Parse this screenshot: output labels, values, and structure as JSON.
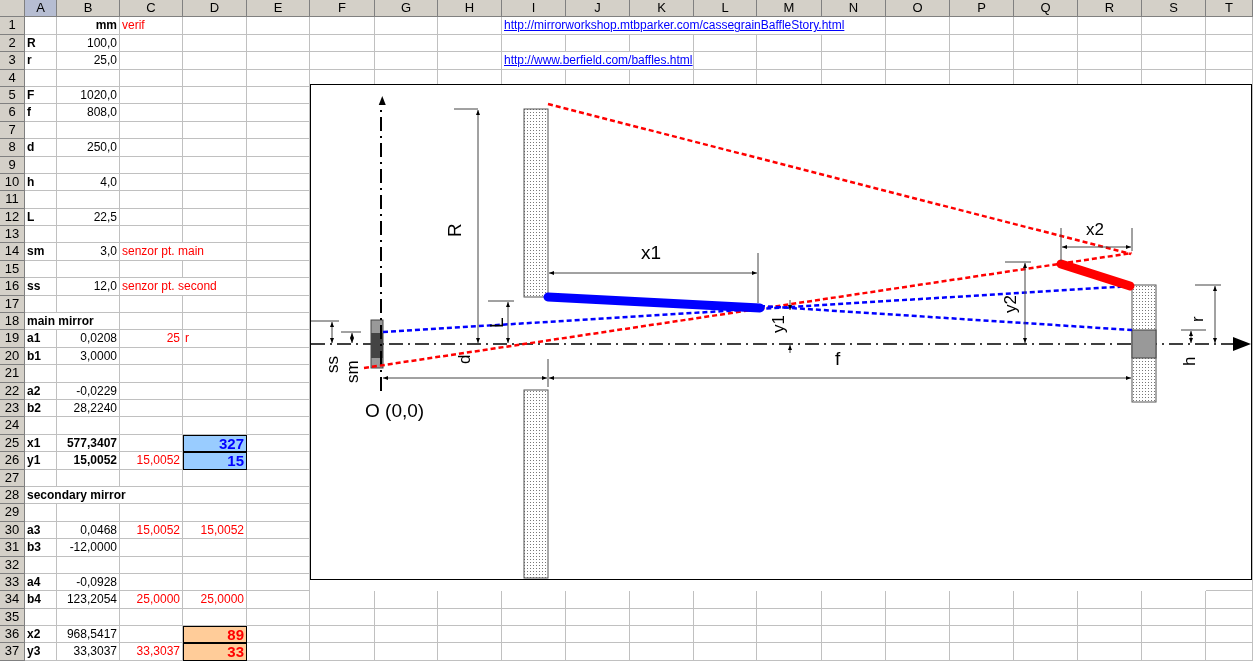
{
  "columns": [
    {
      "label": "A",
      "selected": true
    },
    {
      "label": "B",
      "selected": false
    },
    {
      "label": "C",
      "selected": false
    },
    {
      "label": "D",
      "selected": false
    },
    {
      "label": "E",
      "selected": false
    },
    {
      "label": "F",
      "selected": false
    },
    {
      "label": "G",
      "selected": false
    },
    {
      "label": "H",
      "selected": false
    },
    {
      "label": "I",
      "selected": false
    },
    {
      "label": "J",
      "selected": false
    },
    {
      "label": "K",
      "selected": false
    },
    {
      "label": "L",
      "selected": false
    },
    {
      "label": "M",
      "selected": false
    },
    {
      "label": "N",
      "selected": false
    },
    {
      "label": "O",
      "selected": false
    },
    {
      "label": "P",
      "selected": false
    },
    {
      "label": "Q",
      "selected": false
    },
    {
      "label": "R",
      "selected": false
    },
    {
      "label": "S",
      "selected": false
    },
    {
      "label": "T",
      "selected": false
    }
  ],
  "rows": [
    {
      "number": "1",
      "cells": {
        "B": {
          "text": "mm",
          "kind": "value_bold"
        },
        "C": {
          "text": "verif",
          "kind": "note"
        },
        "I": {
          "text": "http://mirrorworkshop.mtbparker.com/cassegrainBaffleStory.html",
          "kind": "link"
        }
      }
    },
    {
      "number": "2",
      "cells": {
        "A": {
          "text": "R",
          "kind": "label"
        },
        "B": {
          "text": "100,0",
          "kind": "value"
        }
      }
    },
    {
      "number": "3",
      "cells": {
        "A": {
          "text": "r",
          "kind": "label"
        },
        "B": {
          "text": "25,0",
          "kind": "value"
        },
        "I": {
          "text": "http://www.berfield.com/baffles.html",
          "kind": "link"
        }
      }
    },
    {
      "number": "4"
    },
    {
      "number": "5",
      "cells": {
        "A": {
          "text": "F",
          "kind": "label"
        },
        "B": {
          "text": "1020,0",
          "kind": "value"
        }
      }
    },
    {
      "number": "6",
      "cells": {
        "A": {
          "text": "f",
          "kind": "label"
        },
        "B": {
          "text": "808,0",
          "kind": "value"
        }
      }
    },
    {
      "number": "7"
    },
    {
      "number": "8",
      "cells": {
        "A": {
          "text": "d",
          "kind": "label"
        },
        "B": {
          "text": "250,0",
          "kind": "value"
        }
      }
    },
    {
      "number": "9"
    },
    {
      "number": "10",
      "cells": {
        "A": {
          "text": "h",
          "kind": "label"
        },
        "B": {
          "text": "4,0",
          "kind": "value"
        }
      }
    },
    {
      "number": "11"
    },
    {
      "number": "12",
      "cells": {
        "A": {
          "text": "L",
          "kind": "label"
        },
        "B": {
          "text": "22,5",
          "kind": "value"
        }
      }
    },
    {
      "number": "13"
    },
    {
      "number": "14",
      "cells": {
        "A": {
          "text": "sm",
          "kind": "label"
        },
        "B": {
          "text": "3,0",
          "kind": "value"
        },
        "C": {
          "text": "senzor pt. main",
          "kind": "note"
        }
      }
    },
    {
      "number": "15"
    },
    {
      "number": "16",
      "cells": {
        "A": {
          "text": "ss",
          "kind": "label"
        },
        "B": {
          "text": "12,0",
          "kind": "value"
        },
        "C": {
          "text": "senzor pt. second",
          "kind": "note"
        }
      }
    },
    {
      "number": "17"
    },
    {
      "number": "18",
      "cells": {
        "A": {
          "text": "main mirror",
          "kind": "label"
        }
      }
    },
    {
      "number": "19",
      "cells": {
        "A": {
          "text": "a1",
          "kind": "label"
        },
        "B": {
          "text": "0,0208",
          "kind": "value"
        },
        "C": {
          "text": "25",
          "kind": "check"
        },
        "D": {
          "text": "r",
          "kind": "note"
        }
      }
    },
    {
      "number": "20",
      "cells": {
        "A": {
          "text": "b1",
          "kind": "label"
        },
        "B": {
          "text": "3,0000",
          "kind": "value"
        }
      }
    },
    {
      "number": "21"
    },
    {
      "number": "22",
      "cells": {
        "A": {
          "text": "a2",
          "kind": "label"
        },
        "B": {
          "text": "-0,0229",
          "kind": "value"
        }
      }
    },
    {
      "number": "23",
      "cells": {
        "A": {
          "text": "b2",
          "kind": "label"
        },
        "B": {
          "text": "28,2240",
          "kind": "value"
        }
      }
    },
    {
      "number": "24"
    },
    {
      "number": "25",
      "cells": {
        "A": {
          "text": "x1",
          "kind": "label"
        },
        "B": {
          "text": "577,3407",
          "kind": "value_bold"
        },
        "D": {
          "text": "327",
          "kind": "result_blue"
        }
      }
    },
    {
      "number": "26",
      "cells": {
        "A": {
          "text": "y1",
          "kind": "label"
        },
        "B": {
          "text": "15,0052",
          "kind": "value_bold"
        },
        "C": {
          "text": "15,0052",
          "kind": "check"
        },
        "D": {
          "text": "15",
          "kind": "result_blue"
        }
      }
    },
    {
      "number": "27"
    },
    {
      "number": "28",
      "cells": {
        "A": {
          "text": "secondary mirror",
          "kind": "label"
        }
      }
    },
    {
      "number": "29"
    },
    {
      "number": "30",
      "cells": {
        "A": {
          "text": "a3",
          "kind": "label"
        },
        "B": {
          "text": "0,0468",
          "kind": "value"
        },
        "C": {
          "text": "15,0052",
          "kind": "check"
        },
        "D": {
          "text": "15,0052",
          "kind": "check"
        }
      }
    },
    {
      "number": "31",
      "cells": {
        "A": {
          "text": "b3",
          "kind": "label"
        },
        "B": {
          "text": "-12,0000",
          "kind": "value"
        }
      }
    },
    {
      "number": "32"
    },
    {
      "number": "33",
      "cells": {
        "A": {
          "text": "a4",
          "kind": "label"
        },
        "B": {
          "text": "-0,0928",
          "kind": "value"
        }
      }
    },
    {
      "number": "34",
      "cells": {
        "A": {
          "text": "b4",
          "kind": "label"
        },
        "B": {
          "text": "123,2054",
          "kind": "value"
        },
        "C": {
          "text": "25,0000",
          "kind": "check"
        },
        "D": {
          "text": "25,0000",
          "kind": "check"
        }
      }
    },
    {
      "number": "35"
    },
    {
      "number": "36",
      "cells": {
        "A": {
          "text": "x2",
          "kind": "label"
        },
        "B": {
          "text": "968,5417",
          "kind": "value"
        },
        "D": {
          "text": "89",
          "kind": "result_orange"
        }
      }
    },
    {
      "number": "37",
      "cells": {
        "A": {
          "text": "y3",
          "kind": "label"
        },
        "B": {
          "text": "33,3037",
          "kind": "value"
        },
        "C": {
          "text": "33,3037",
          "kind": "check"
        },
        "D": {
          "text": "33",
          "kind": "result_orange"
        }
      }
    }
  ],
  "diagram": {
    "labels": {
      "big_radius": "R",
      "x1": "x1",
      "baffle_length": "L",
      "distance": "d",
      "y1": "y1",
      "focal": "f",
      "ss": "ss",
      "sm": "sm",
      "origin": "O (0,0)",
      "x2": "x2",
      "y2": "y2",
      "small_radius": "r",
      "hole": "h"
    }
  }
}
